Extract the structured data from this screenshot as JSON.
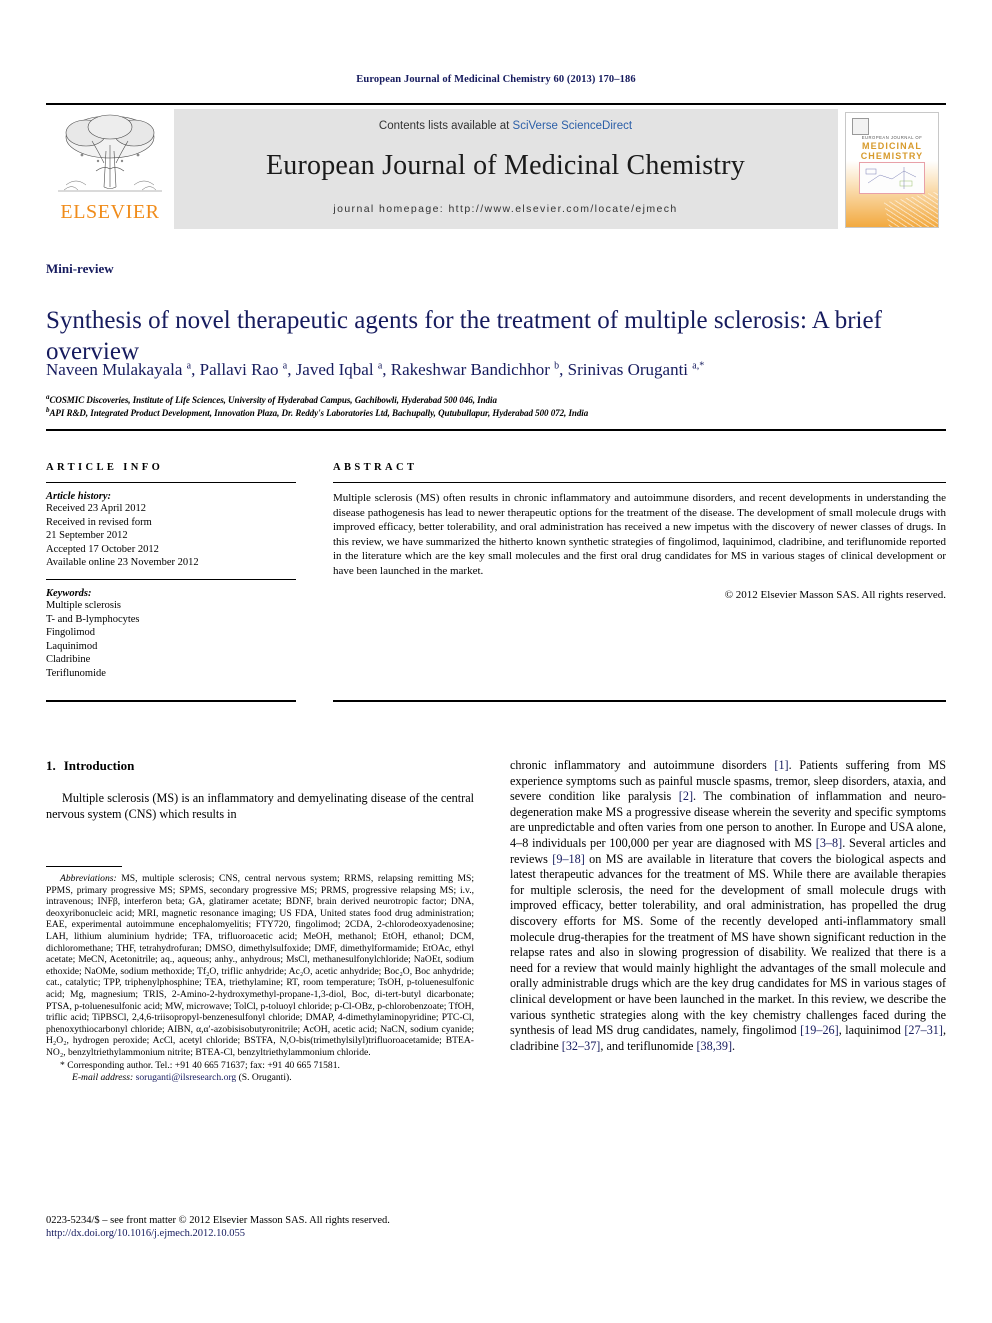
{
  "running_head": "European Journal of Medicinal Chemistry 60 (2013) 170–186",
  "masthead": {
    "publisher": "ELSEVIER",
    "contents_prefix": "Contents lists available at ",
    "contents_link": "SciVerse ScienceDirect",
    "journal_title": "European Journal of Medicinal Chemistry",
    "homepage_label": "journal homepage: http://www.elsevier.com/locate/ejmech",
    "cover": {
      "line1": "EUROPEAN JOURNAL OF",
      "line2": "MEDICINAL",
      "line3": "CHEMISTRY"
    }
  },
  "article": {
    "doc_type": "Mini-review",
    "title": "Synthesis of novel therapeutic agents for the treatment of multiple sclerosis: A brief overview",
    "authors_html": "Naveen Mulakayala <sup>a</sup>, Pallavi Rao <sup>a</sup>, Javed Iqbal <sup>a</sup>, Rakeshwar Bandichhor <sup>b</sup>, Srinivas Oruganti <sup>a,*</sup>",
    "affiliation_a": "COSMIC Discoveries, Institute of Life Sciences, University of Hyderabad Campus, Gachibowli, Hyderabad 500 046, India",
    "affiliation_b": "API R&D, Integrated Product Development, Innovation Plaza, Dr. Reddy's Laboratories Ltd, Bachupally, Qutubullapur, Hyderabad 500 072, India"
  },
  "article_info": {
    "heading": "ARTICLE INFO",
    "history_label": "Article history:",
    "history": [
      "Received 23 April 2012",
      "Received in revised form",
      "21 September 2012",
      "Accepted 17 October 2012",
      "Available online 23 November 2012"
    ],
    "keywords_label": "Keywords:",
    "keywords": [
      "Multiple sclerosis",
      "T- and B-lymphocytes",
      "Fingolimod",
      "Laquinimod",
      "Cladribine",
      "Teriflunomide"
    ]
  },
  "abstract": {
    "heading": "ABSTRACT",
    "text": "Multiple sclerosis (MS) often results in chronic inflammatory and autoimmune disorders, and recent developments in understanding the disease pathogenesis has lead to newer therapeutic options for the treatment of the disease. The development of small molecule drugs with improved efficacy, better tolerability, and oral administration has received a new impetus with the discovery of newer classes of drugs. In this review, we have summarized the hitherto known synthetic strategies of fingolimod, laquinimod, cladribine, and teriflunomide reported in the literature which are the key small molecules and the first oral drug candidates for MS in various stages of clinical development or have been launched in the market.",
    "copyright": "© 2012 Elsevier Masson SAS. All rights reserved."
  },
  "introduction": {
    "number": "1.",
    "heading": "Introduction",
    "left_para": "Multiple sclerosis (MS) is an inflammatory and demyelinating disease of the central nervous system (CNS) which results in"
  },
  "right_column": {
    "p1_a": "chronic inflammatory and autoimmune disorders ",
    "p1_r1": "[1]",
    "p1_b": ". Patients suffering from MS experience symptoms such as painful muscle spasms, tremor, sleep disorders, ataxia, and severe condition like paralysis ",
    "p1_r2": "[2]",
    "p1_c": ". The combination of inflammation and neuro-degeneration make MS a progressive disease wherein the severity and specific symptoms are unpredictable and often varies from one person to another. In Europe and USA alone, 4–8 individuals per 100,000 per year are diagnosed with MS ",
    "p1_r3": "[3–8]",
    "p1_d": ". Several articles and reviews ",
    "p1_r4": "[9–18]",
    "p1_e": " on MS are available in literature that covers the biological aspects and latest therapeutic advances for the treatment of MS. While there are available therapies for multiple sclerosis, the need for the development of small molecule drugs with improved efficacy, better tolerability, and oral administration, has propelled the drug discovery efforts for MS. Some of the recently developed anti-inflammatory small molecule drug-therapies for the treatment of MS have shown significant reduction in the relapse rates and also in slowing progression of disability. We realized that there is a need for a review that would mainly highlight the advantages of the small molecule and orally administrable drugs which are the key drug candidates for MS in various stages of clinical development or have been launched in the market. In this review, we describe the various synthetic strategies along with the key chemistry challenges faced during the synthesis of lead MS drug candidates, namely, fingolimod ",
    "p1_r5": "[19–26]",
    "p1_f": ", laquinimod ",
    "p1_r6": "[27–31]",
    "p1_g": ", cladribine ",
    "p1_r7": "[32–37]",
    "p1_h": ", and teriflunomide ",
    "p1_r8": "[38,39]",
    "p1_i": "."
  },
  "footnotes": {
    "abbrev_label": "Abbreviations:",
    "abbrev_text": " MS, multiple sclerosis; CNS, central nervous system; RRMS, relapsing remitting MS; PPMS, primary progressive MS; SPMS, secondary progressive MS; PRMS, progressive relapsing MS; i.v., intravenous; INFβ, interferon beta; GA, glatiramer acetate; BDNF, brain derived neurotropic factor; DNA, deoxyribonucleic acid; MRI, magnetic resonance imaging; US FDA, United states food drug administration; EAE, experimental autoimmune encephalomyelitis; FTY720, fingolimod; 2CDA, 2-chlorodeoxyadenosine; LAH, lithium aluminium hydride; TFA, trifluoroacetic acid; MeOH, methanol; EtOH, ethanol; DCM, dichloromethane; THF, tetrahydrofuran; DMSO, dimethylsulfoxide; DMF, dimethylformamide; EtOAc, ethyl acetate; MeCN, Acetonitrile; aq., aqueous; anhy., anhydrous; MsCl, methanesulfonylchloride; NaOEt, sodium ethoxide; NaOMe, sodium methoxide; Tf₂O, triflic anhydride; Ac₂O, acetic anhydride; Boc₂O, Boc anhydride; cat., catalytic; TPP, triphenylphosphine; TEA, triethylamine; RT, room temperature; TsOH, p-toluenesulfonic acid; Mg, magnesium; TRIS, 2-Amino-2-hydroxymethyl-propane-1,3-diol, Boc, di-tert-butyl dicarbonate; PTSA, p-toluenesulfonic acid; MW, microwave; TolCl, p-toluoyl chloride; p-Cl-OBz, p-chlorobenzoate; TfOH, triflic acid; TiPBSCl, 2,4,6-triisopropyl-benzenesulfonyl chloride; DMAP, 4-dimethylaminopyridine; PTC-Cl, phenoxythiocarbonyl chloride; AIBN, α,α′-azobisisobutyronitrile; AcOH, acetic acid; NaCN, sodium cyanide; H₂O₂, hydrogen peroxide; AcCl, acetyl chloride; BSTFA, N,O-bis(trimethylsilyl)trifluoroacetamide; BTEA-NO₂, benzyltriethylammonium nitrite; BTEA-Cl, benzyltriethylammonium chloride.",
    "corresponding": "* Corresponding author. Tel.: +91 40 665 71637; fax: +91 40 665 71581.",
    "email_label": "E-mail address:",
    "email": "soruganti@ilsresearch.org",
    "email_suffix": " (S. Oruganti).",
    "issn_line": "0223-5234/$ – see front matter © 2012 Elsevier Masson SAS. All rights reserved.",
    "doi": "http://dx.doi.org/10.1016/j.ejmech.2012.10.055"
  }
}
